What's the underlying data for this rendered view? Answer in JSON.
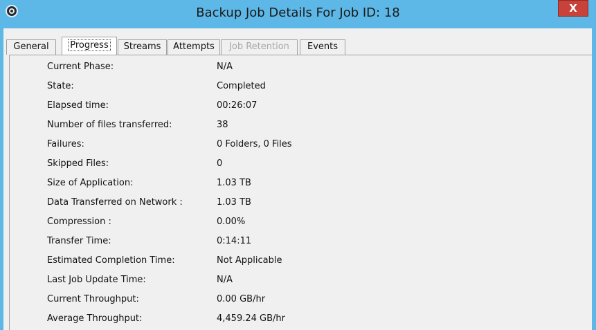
{
  "window": {
    "title": "Backup Job Details For Job ID: 18",
    "close_label": "X",
    "icon": "shield-app-icon"
  },
  "tabs": [
    {
      "label": "General"
    },
    {
      "label": "Progress"
    },
    {
      "label": "Streams"
    },
    {
      "label": "Attempts"
    },
    {
      "label": "Job Retention"
    },
    {
      "label": "Events"
    }
  ],
  "active_tab": "Progress",
  "disabled_tab": "Job Retention",
  "progress": {
    "rows": [
      {
        "label": "Current Phase:",
        "value": "N/A"
      },
      {
        "label": "State:",
        "value": "Completed"
      },
      {
        "label": "Elapsed time:",
        "value": "00:26:07"
      },
      {
        "label": "Number of files transferred:",
        "value": "38"
      },
      {
        "label": "Failures:",
        "value": "0 Folders, 0 Files"
      },
      {
        "label": "Skipped Files:",
        "value": "0"
      },
      {
        "label": "Size of Application:",
        "value": "1.03 TB"
      },
      {
        "label": "Data Transferred on Network :",
        "value": "1.03 TB"
      },
      {
        "label": "Compression :",
        "value": "0.00%"
      },
      {
        "label": "Transfer Time:",
        "value": "0:14:11"
      },
      {
        "label": "Estimated Completion Time:",
        "value": "Not Applicable"
      },
      {
        "label": "Last Job Update Time:",
        "value": "N/A"
      },
      {
        "label": "Current Throughput:",
        "value": "0.00 GB/hr"
      },
      {
        "label": "Average Throughput:",
        "value": "4,459.24 GB/hr"
      }
    ]
  },
  "colors": {
    "titlebar": "#5db8e7",
    "close_button": "#c8413a",
    "panel": "#f0f0f0"
  }
}
